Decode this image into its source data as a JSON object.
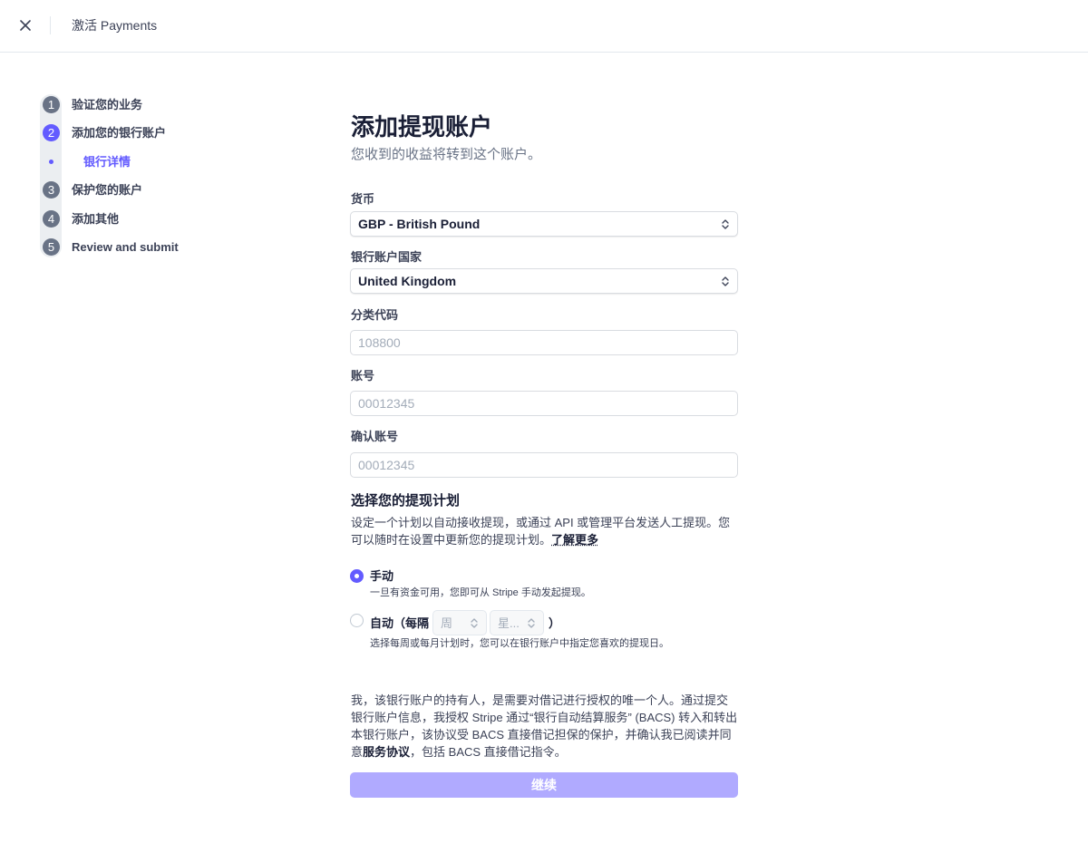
{
  "header": {
    "title": "激活 Payments"
  },
  "sidebar": {
    "steps": [
      {
        "number": "1",
        "label": "验证您的业务"
      },
      {
        "number": "2",
        "label": "添加您的银行账户"
      },
      {
        "number": "3",
        "label": "保护您的账户"
      },
      {
        "number": "4",
        "label": "添加其他"
      },
      {
        "number": "5",
        "label": "Review and submit"
      }
    ],
    "active_substep": "银行详情"
  },
  "form": {
    "title": "添加提现账户",
    "subtitle": "您收到的收益将转到这个账户。",
    "currency": {
      "label": "货币",
      "value": "GBP - British Pound"
    },
    "country": {
      "label": "银行账户国家",
      "value": "United Kingdom"
    },
    "sort_code": {
      "label": "分类代码",
      "placeholder": "108800"
    },
    "account_number": {
      "label": "账号",
      "placeholder": "00012345"
    },
    "confirm_account": {
      "label": "确认账号",
      "placeholder": "00012345"
    }
  },
  "payout_schedule": {
    "title": "选择您的提现计划",
    "description": "设定一个计划以自动接收提现，或通过 API 或管理平台发送人工提现。您可以随时在设置中更新您的提现计划。",
    "learn_more": "了解更多",
    "manual": {
      "label": "手动",
      "help": "一旦有资金可用，您即可从 Stripe 手动发起提现。",
      "selected": true
    },
    "automatic": {
      "label_prefix": "自动（每隔",
      "label_suffix": "）",
      "interval_value": "周",
      "day_value": "星...",
      "help": "选择每周或每月计划时，您可以在银行账户中指定您喜欢的提现日。",
      "selected": false
    }
  },
  "legal": {
    "text_before": "我，该银行账户的持有人，是需要对借记进行授权的唯一个人。通过提交银行账户信息，我授权 Stripe 通过“银行自动结算服务” (BACS) 转入和转出本银行账户，该协议受 BACS 直接借记担保的保护，并确认我已阅读并同意",
    "agreement_link": "服务协议",
    "text_after": "，包括 BACS 直接借记指令。"
  },
  "continue_button": "继续",
  "colors": {
    "accent": "#635bff",
    "button_disabled": "#b0aaff",
    "step_inactive": "#697386"
  }
}
